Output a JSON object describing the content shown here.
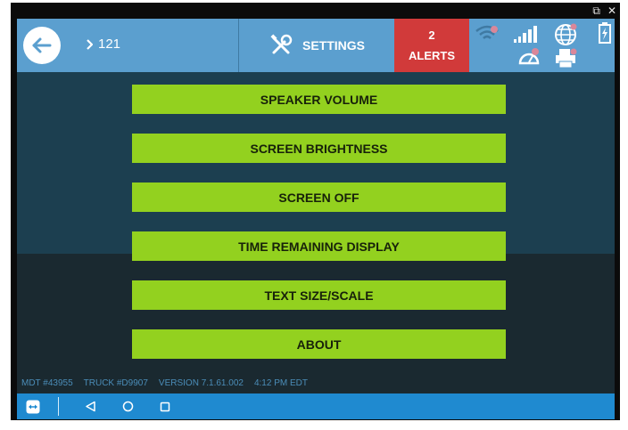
{
  "window": {
    "restore_glyph": "⧉",
    "close_glyph": "✕"
  },
  "header": {
    "route_number": "121",
    "settings_label": "SETTINGS",
    "alerts_count": "2",
    "alerts_label": "ALERTS"
  },
  "menu": {
    "items": [
      {
        "label": "SPEAKER VOLUME"
      },
      {
        "label": "SCREEN BRIGHTNESS"
      },
      {
        "label": "SCREEN OFF"
      },
      {
        "label": "TIME REMAINING DISPLAY"
      },
      {
        "label": "TEXT SIZE/SCALE"
      },
      {
        "label": "ABOUT"
      }
    ]
  },
  "footer": {
    "mdt": "MDT #43955",
    "truck": "TRUCK #D9907",
    "version": "VERSION  7.1.61.002",
    "time": "4:12 PM EDT"
  },
  "colors": {
    "header_blue": "#5b9fcf",
    "alerts_red": "#d13a3a",
    "button_green": "#93d11f",
    "nav_blue": "#1f8ad0",
    "panel_top": "#1c3f50",
    "panel_bottom": "#1a2930",
    "footer_text": "#4b8db8"
  },
  "icons": {
    "back": "arrow-left-icon",
    "route": "chevron-right-icon",
    "settings": "wrench-screwdriver-icon",
    "status": [
      "wifi-icon",
      "signal-bars-icon",
      "globe-icon",
      "battery-icon",
      "speedometer-icon",
      "printer-icon"
    ],
    "nav": [
      "remote-app-icon",
      "back-triangle-icon",
      "home-circle-icon",
      "recents-square-icon"
    ]
  }
}
